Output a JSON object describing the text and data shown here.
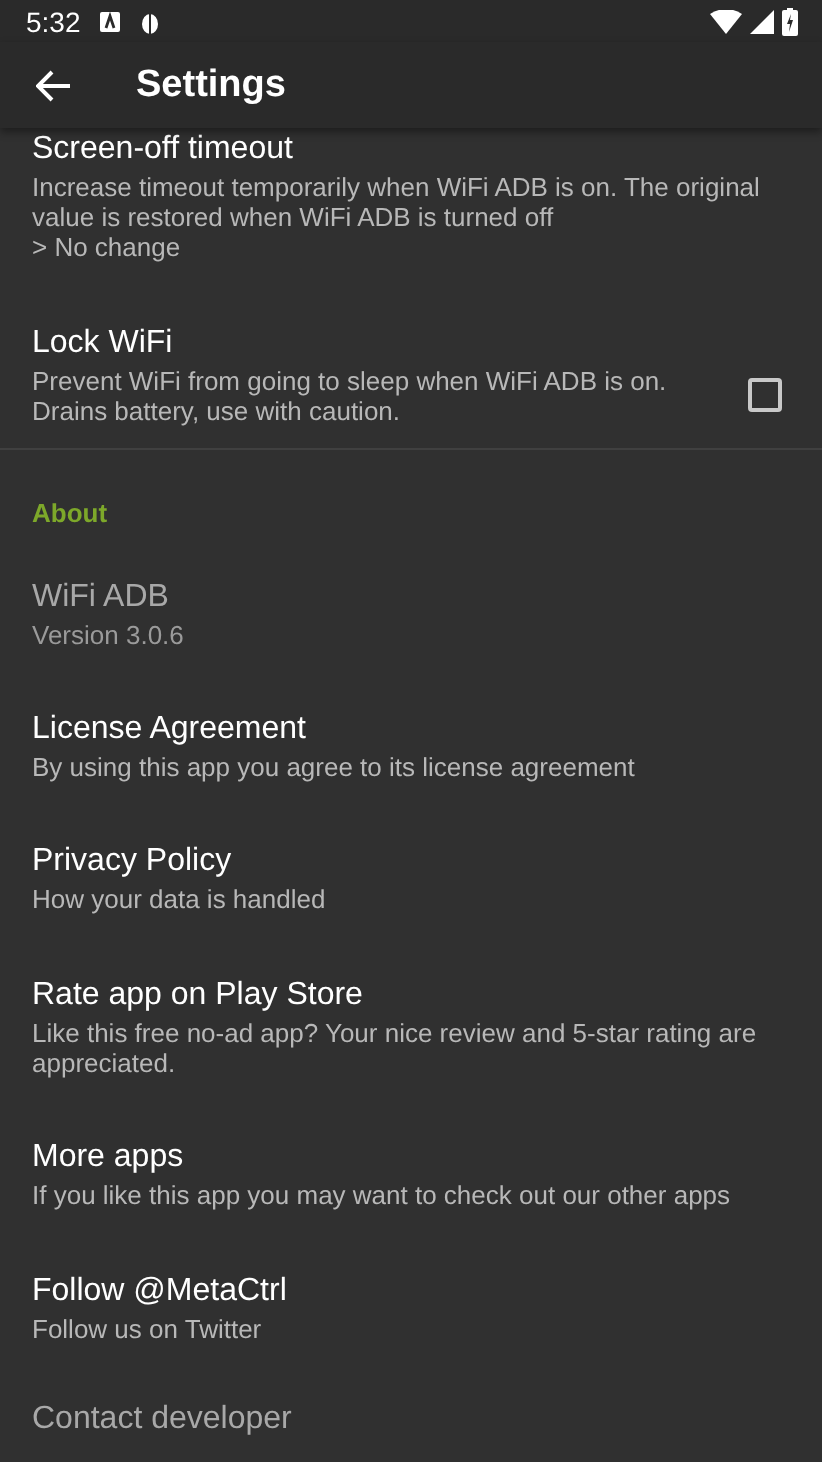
{
  "status_bar": {
    "time": "5:32"
  },
  "app_bar": {
    "title": "Settings"
  },
  "items": [
    {
      "kind": "preference",
      "title": "Screen-off timeout",
      "summary": "Increase timeout temporarily when WiFi ADB is on. The original value is restored when WiFi ADB is turned off\n> No change",
      "disabled": false
    },
    {
      "kind": "checkbox",
      "title": "Lock WiFi",
      "summary": "Prevent WiFi from going to sleep when WiFi ADB is on.\nDrains battery, use with caution.",
      "checked": false,
      "disabled": false
    },
    {
      "kind": "header",
      "title": "About"
    },
    {
      "kind": "preference",
      "title": "WiFi ADB",
      "summary": "Version 3.0.6",
      "disabled": true
    },
    {
      "kind": "preference",
      "title": "License Agreement",
      "summary": "By using this app you agree to its license agreement",
      "disabled": false
    },
    {
      "kind": "preference",
      "title": "Privacy Policy",
      "summary": "How your data is handled",
      "disabled": false
    },
    {
      "kind": "preference",
      "title": "Rate app on Play Store",
      "summary": "Like this free no-ad app? Your nice review and 5-star rating are appreciated.",
      "disabled": false
    },
    {
      "kind": "preference",
      "title": "More apps",
      "summary": "If you like this app you may want to check out our other apps",
      "disabled": false
    },
    {
      "kind": "preference",
      "title": "Follow @MetaCtrl",
      "summary": "Follow us on Twitter",
      "disabled": false
    },
    {
      "kind": "preference",
      "title": "Contact developer",
      "disabled": true
    }
  ]
}
